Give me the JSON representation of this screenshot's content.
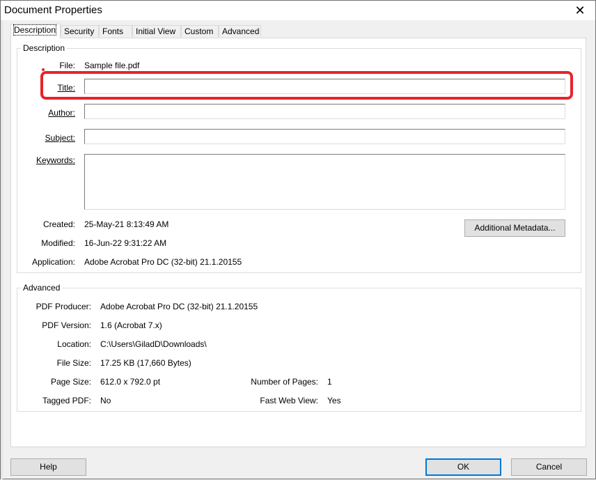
{
  "window": {
    "title": "Document Properties",
    "close_glyph": "✕"
  },
  "tabs": [
    {
      "label": "Description",
      "active": true
    },
    {
      "label": "Security"
    },
    {
      "label": "Fonts"
    },
    {
      "label": "Initial View"
    },
    {
      "label": "Custom"
    },
    {
      "label": "Advanced"
    }
  ],
  "description": {
    "group_title": "Description",
    "file_label": "File:",
    "file_value": "Sample file.pdf",
    "title_label": "Title:",
    "title_value": "",
    "author_label": "Author:",
    "author_value": "",
    "subject_label": "Subject:",
    "subject_value": "",
    "keywords_label": "Keywords:",
    "keywords_value": "",
    "created_label": "Created:",
    "created_value": "25-May-21 8:13:49 AM",
    "modified_label": "Modified:",
    "modified_value": "16-Jun-22 9:31:22 AM",
    "application_label": "Application:",
    "application_value": "Adobe Acrobat Pro DC (32-bit) 21.1.20155",
    "metadata_button": "Additional Metadata..."
  },
  "advanced": {
    "group_title": "Advanced",
    "producer_label": "PDF Producer:",
    "producer_value": "Adobe Acrobat Pro DC (32-bit) 21.1.20155",
    "version_label": "PDF Version:",
    "version_value": "1.6 (Acrobat 7.x)",
    "location_label": "Location:",
    "location_value": "C:\\Users\\GiladD\\Downloads\\",
    "filesize_label": "File Size:",
    "filesize_value": "17.25 KB (17,660 Bytes)",
    "pagesize_label": "Page Size:",
    "pagesize_value": "612.0 x 792.0 pt",
    "pages_label": "Number of Pages:",
    "pages_value": "1",
    "tagged_label": "Tagged PDF:",
    "tagged_value": "No",
    "fastweb_label": "Fast Web View:",
    "fastweb_value": "Yes"
  },
  "footer": {
    "help": "Help",
    "ok": "OK",
    "cancel": "Cancel"
  },
  "colors": {
    "highlight": "#e8232a",
    "default_button_border": "#0078d7"
  }
}
